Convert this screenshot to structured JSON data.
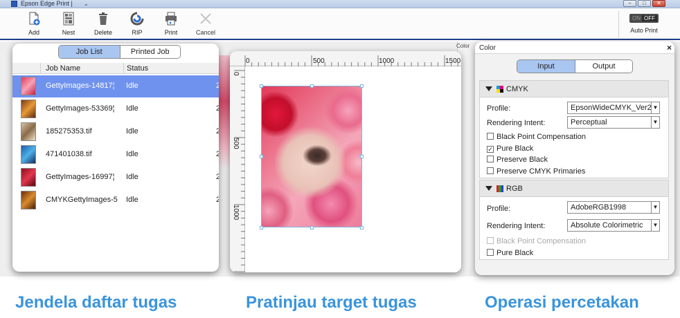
{
  "window": {
    "title": "Epson Edge Print |",
    "dropdown": "⌄",
    "controls": [
      "−",
      "□",
      "✕"
    ]
  },
  "toolbar": {
    "buttons": [
      {
        "label": "Add",
        "icon": "add-file-icon"
      },
      {
        "label": "Nest",
        "icon": "nest-icon"
      },
      {
        "label": "Delete",
        "icon": "trash-icon"
      },
      {
        "label": "RIP",
        "icon": "rip-icon"
      },
      {
        "label": "Print",
        "icon": "printer-icon"
      },
      {
        "label": "Cancel",
        "icon": "cancel-x-icon"
      }
    ],
    "autoprint": {
      "on": "ON",
      "off": "OFF",
      "label": "Auto Print",
      "state": "off"
    }
  },
  "joblist": {
    "tabs": [
      {
        "label": "Job List",
        "active": true
      },
      {
        "label": "Printed Job",
        "active": false
      }
    ],
    "columns": {
      "name": "Job Name",
      "status": "Status"
    },
    "rows": [
      {
        "name": "GettyImages-14817¦",
        "status": "Idle",
        "edge": "2",
        "selected": true
      },
      {
        "name": "GettyImages-53369¦",
        "status": "Idle",
        "edge": "2",
        "selected": false
      },
      {
        "name": "185275353.tif",
        "status": "Idle",
        "edge": "2",
        "selected": false
      },
      {
        "name": "471401038.tif",
        "status": "Idle",
        "edge": "2",
        "selected": false
      },
      {
        "name": "GettyImages-16997¦",
        "status": "Idle",
        "edge": "2",
        "selected": false
      },
      {
        "name": "CMYKGettyImages-5",
        "status": "Idle",
        "edge": "2",
        "selected": false
      }
    ]
  },
  "preview": {
    "ruler_h": [
      "0",
      "500",
      "1000",
      "1500"
    ],
    "ruler_v": [
      "0",
      "500",
      "1000"
    ]
  },
  "behind_text": {
    "color": "Color"
  },
  "color_panel": {
    "title": "Color",
    "close": "×",
    "tabs": [
      {
        "label": "Input",
        "active": true
      },
      {
        "label": "Output",
        "active": false
      }
    ],
    "cmyk": {
      "title": "CMYK",
      "profile_label": "Profile:",
      "profile_value": "EpsonWideCMYK_Ver2",
      "intent_label": "Rendering Intent:",
      "intent_value": "Perceptual",
      "options": [
        {
          "label": "Black Point Compensation",
          "checked": false,
          "disabled": false
        },
        {
          "label": "Pure Black",
          "checked": true,
          "disabled": false
        },
        {
          "label": "Preserve Black",
          "checked": false,
          "disabled": false
        },
        {
          "label": "Preserve CMYK Primaries",
          "checked": false,
          "disabled": false
        }
      ]
    },
    "rgb": {
      "title": "RGB",
      "profile_label": "Profile:",
      "profile_value": "AdobeRGB1998",
      "intent_label": "Rendering Intent:",
      "intent_value": "Absolute Colorimetric",
      "options": [
        {
          "label": "Black Point Compensation",
          "checked": false,
          "disabled": true
        },
        {
          "label": "Pure Black",
          "checked": false,
          "disabled": false
        }
      ]
    }
  },
  "captions": {
    "left": "Jendela daftar tugas",
    "middle": "Pratinjau target tugas",
    "right": "Operasi percetakan"
  },
  "colors": {
    "accent": "#3a94dd",
    "selection": "#6f92ee",
    "tab_active": "#a9c6f1"
  }
}
